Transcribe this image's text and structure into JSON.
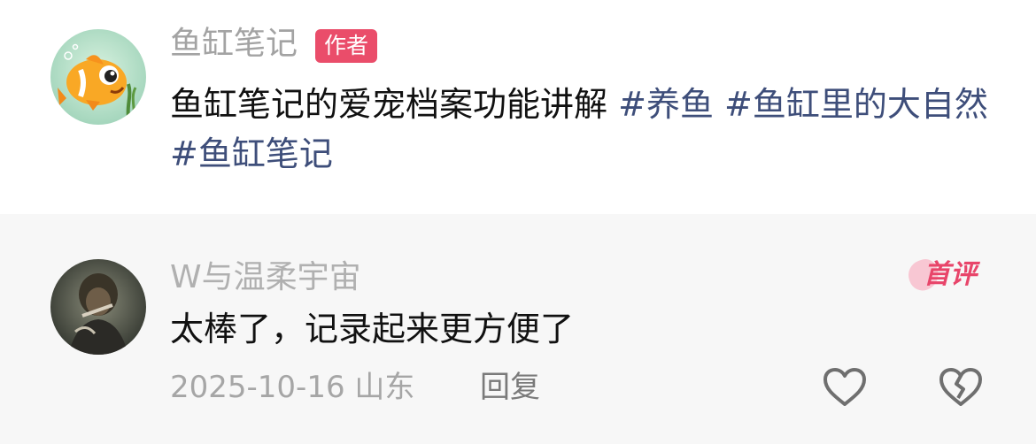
{
  "post": {
    "author_name": "鱼缸笔记",
    "author_badge": "作者",
    "text": "鱼缸笔记的爱宠档案功能讲解",
    "tags": [
      "#养鱼",
      "#鱼缸里的大自然",
      "#鱼缸笔记"
    ],
    "avatar_icon": "goldfish-avatar-icon"
  },
  "comment": {
    "user_name": "W与温柔宇宙",
    "badge": "首评",
    "text": "太棒了，记录起来更方便了",
    "date": "2025-10-16",
    "location": "山东",
    "reply_label": "回复",
    "like_icon": "heart-outline-icon",
    "dislike_icon": "broken-heart-icon"
  },
  "colors": {
    "author_badge_bg": "#ea4d6a",
    "tag_color": "#3e4e7a",
    "first_badge_color": "#e8456a",
    "comment_bg": "#f7f7f7"
  }
}
